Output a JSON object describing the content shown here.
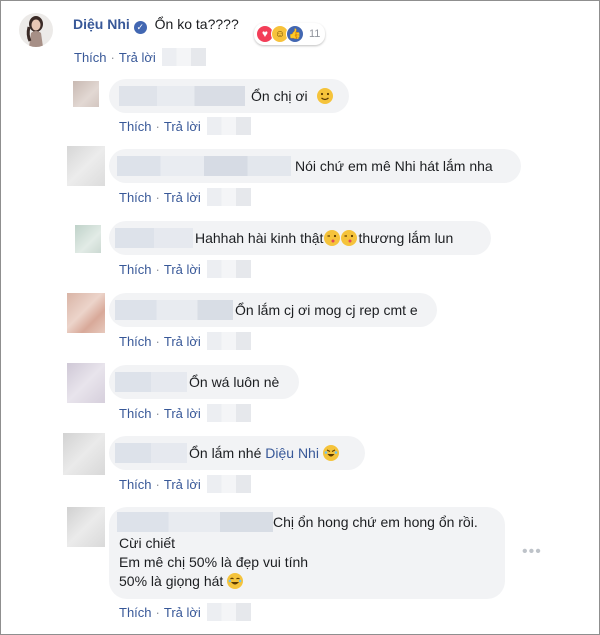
{
  "colors": {
    "link": "#385898",
    "bubble": "#f2f3f5",
    "meta": "#90949c"
  },
  "actions": {
    "like": "Thích",
    "reply": "Trả lời",
    "separator": "·"
  },
  "main_comment": {
    "author": "Diệu Nhi",
    "text": "Ổn ko ta????",
    "verified_icon": "check-badge-icon",
    "reaction_icons": [
      "love-icon",
      "haha-icon",
      "like-icon"
    ],
    "reaction_count": "11"
  },
  "replies": [
    {
      "text": "Ổn chị ơi",
      "emoji": "blush-emoji"
    },
    {
      "text": "Nói chứ em mê Nhi hát lắm nha"
    },
    {
      "text_before": "Hahhah hài kinh thật",
      "text_after": "thương lắm lun",
      "emoji": "kiss-emoji"
    },
    {
      "text": "Ổn lắm cj ơi mog cj rep cmt e"
    },
    {
      "text": "Ổn wá luôn nè"
    },
    {
      "text_before": "Ổn lắm nhé",
      "mention": "Diệu Nhi",
      "emoji": "rofl-emoji"
    },
    {
      "lines": [
        "Chị ổn hong chứ em hong ổn rồi.",
        "Cừi chiết",
        "Em mê chị 50% là đẹp vui tính",
        "50% là giọng hát"
      ],
      "emoji": "laugh-emoji"
    }
  ]
}
